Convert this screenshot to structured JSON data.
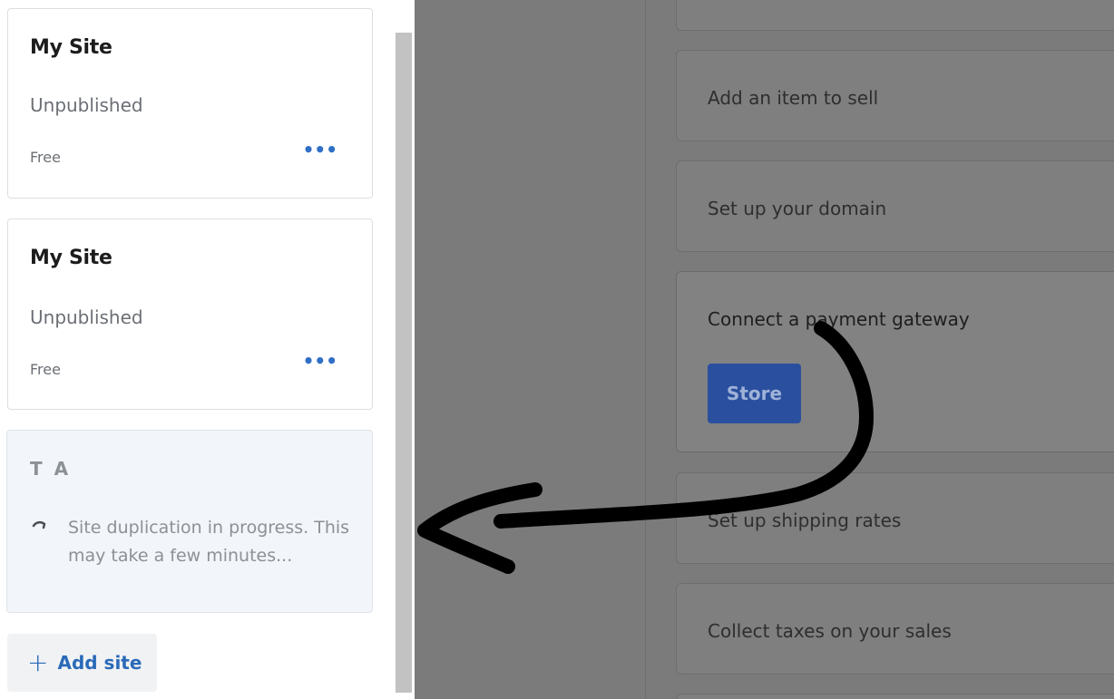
{
  "sites": [
    {
      "title": "My Site",
      "status": "Unpublished",
      "plan": "Free",
      "more_label": "•••"
    },
    {
      "title": "My Site",
      "status": "Unpublished",
      "plan": "Free",
      "more_label": "•••"
    }
  ],
  "duplicating_site": {
    "title": "T A",
    "message": "Site duplication in progress. This may take a few minutes..."
  },
  "add_site": {
    "icon": "+",
    "label": "Add site"
  },
  "tasks": [
    {
      "label": "Add an item to sell"
    },
    {
      "label": "Set up your domain"
    },
    {
      "label": "Connect a payment gateway",
      "button_label": "Store"
    },
    {
      "label": "Set up shipping rates"
    },
    {
      "label": "Collect taxes on your sales"
    }
  ],
  "colors": {
    "accent": "#2a6ab8",
    "overlay": "#7b7b7b",
    "store_button": "#2a4f9e"
  },
  "icons": [
    "more-dots-icon",
    "spinner-icon",
    "plus-icon",
    "hand-drawn-arrow"
  ]
}
